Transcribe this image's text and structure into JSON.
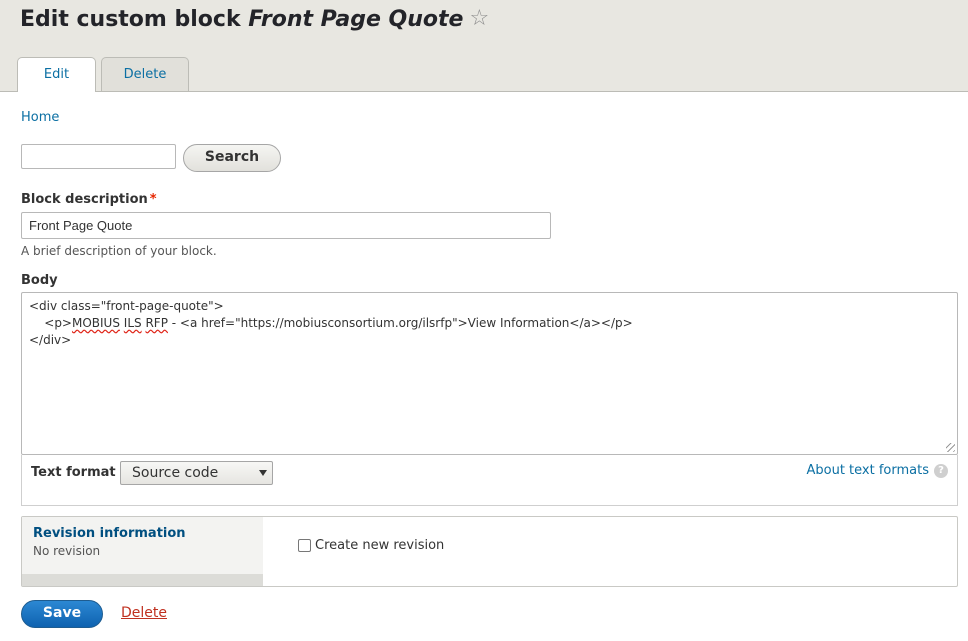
{
  "header": {
    "title_prefix": "Edit custom block ",
    "title_block_name": "Front Page Quote",
    "shortcut_icon": "star-icon",
    "tabs": [
      {
        "label": "Edit",
        "active": true
      },
      {
        "label": "Delete",
        "active": false
      }
    ]
  },
  "breadcrumb": {
    "home": "Home"
  },
  "search": {
    "value": "",
    "button_label": "Search"
  },
  "block_description": {
    "label": "Block description",
    "required_marker": "*",
    "value": "Front Page Quote",
    "help": "A brief description of your block."
  },
  "body": {
    "label": "Body",
    "lines": [
      "<div class=\"front-page-quote\">",
      "    <p>",
      "MOBIUS",
      " ",
      "ILS",
      " ",
      "RFP",
      " - <a href=\"https://mobiusconsortium.org/ilsrfp\">View Information</a></p>",
      "</div>"
    ]
  },
  "text_format": {
    "label": "Text format",
    "selected": "Source code",
    "about_link": "About text formats",
    "help_icon": "question-icon"
  },
  "revision": {
    "title": "Revision information",
    "summary": "No revision",
    "checkbox_label": "Create new revision",
    "checked": false
  },
  "actions": {
    "save": "Save",
    "delete": "Delete"
  },
  "colors": {
    "link": "#0b6fa3",
    "primary_button": "#0e62b0",
    "danger_link": "#c0301f",
    "required": "#e62600"
  }
}
